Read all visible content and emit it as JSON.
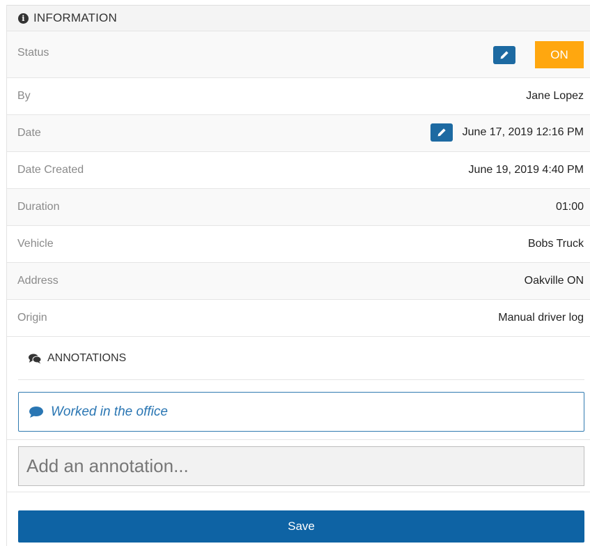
{
  "information": {
    "title": "INFORMATION",
    "rows": {
      "status": {
        "label": "Status",
        "value": "ON"
      },
      "by": {
        "label": "By",
        "value": "Jane Lopez"
      },
      "date": {
        "label": "Date",
        "value": "June 17, 2019 12:16 PM"
      },
      "date_created": {
        "label": "Date Created",
        "value": "June 19, 2019 4:40 PM"
      },
      "duration": {
        "label": "Duration",
        "value": "01:00"
      },
      "vehicle": {
        "label": "Vehicle",
        "value": "Bobs Truck"
      },
      "address": {
        "label": "Address",
        "value": "Oakville ON"
      },
      "origin": {
        "label": "Origin",
        "value": "Manual driver log"
      }
    }
  },
  "annotations": {
    "title": "ANNOTATIONS",
    "items": [
      "Worked in the office"
    ],
    "input_placeholder": "Add an annotation...",
    "save_label": "Save"
  },
  "colors": {
    "edit_button": "#1d6aa2",
    "status_on": "#ffa70f",
    "save_button": "#0e63a4",
    "annotation_text": "#2a76b3"
  },
  "icons": {
    "header": "info-circle-icon",
    "edit": "pencil-icon",
    "annotations_header": "comments-icon",
    "annotation_item": "comment-icon"
  }
}
